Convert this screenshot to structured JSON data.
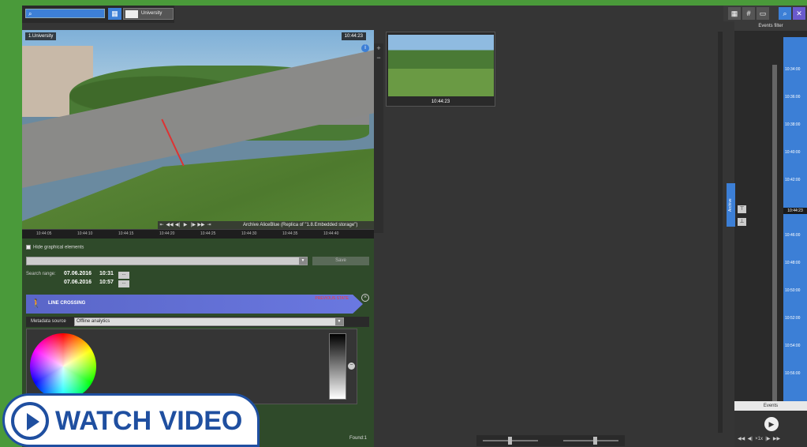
{
  "layout": {
    "name": "University"
  },
  "camera": {
    "title": "1.University",
    "time": "10:44:23",
    "archive_label": "Archive AliceBlue (Replica of \"1.8.Embedded storage\")",
    "timeline_ticks": [
      "10:44:05",
      "10:44:10",
      "10:44:15",
      "10:44:20",
      "10:44:25",
      "10:44:30",
      "10:44:35",
      "10:44:40"
    ]
  },
  "search_panel": {
    "hide_graphical_elements": "Hide graphical elements",
    "save_label": "Save",
    "search_range_label": "Search range:",
    "range_from_date": "07.06.2016",
    "range_from_time": "10:31",
    "range_to_date": "07.06.2016",
    "range_to_time": "10:57",
    "range_button": "...",
    "detector_label": "LINE CROSSING",
    "detector_status": "PREVIOUS STATE",
    "metadata_label": "Metadata source",
    "metadata_value": "Offline analytics",
    "found_label": "Found:1"
  },
  "thumbnail": {
    "time": "10:44:23"
  },
  "events_panel": {
    "header": "Events filter",
    "archive_tab": "Archive",
    "current_time": "10:44:23",
    "ticks": [
      "10:34:00",
      "10:36:00",
      "10:38:00",
      "10:40:00",
      "10:42:00",
      "10:46:00",
      "10:48:00",
      "10:50:00",
      "10:52:00",
      "10:54:00",
      "10:56:00"
    ],
    "events_label": "Events",
    "speed_label": "×1x"
  },
  "watch_video": {
    "label": "WATCH VIDEO"
  },
  "colors": {
    "accent": "#3c7fd6",
    "brand": "#1f4fa0",
    "panel_green": "#2f4a2a"
  }
}
